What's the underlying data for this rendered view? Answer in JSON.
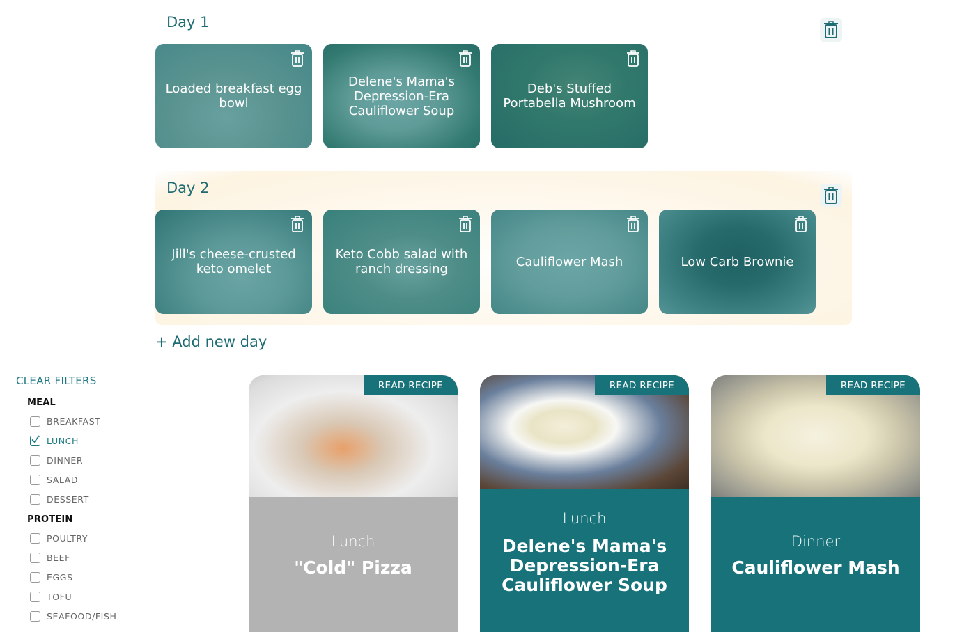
{
  "days": [
    {
      "title": "Day 1",
      "recipes": [
        {
          "name": "Loaded breakfast egg bowl"
        },
        {
          "name": "Delene's Mama's Depression-Era Cauliflower Soup"
        },
        {
          "name": "Deb's Stuffed Portabella Mushroom"
        }
      ]
    },
    {
      "title": "Day 2",
      "recipes": [
        {
          "name": "Jill's cheese-crusted keto omelet"
        },
        {
          "name": "Keto Cobb salad with ranch dressing"
        },
        {
          "name": "Cauliflower Mash"
        },
        {
          "name": "Low Carb Brownie"
        }
      ]
    }
  ],
  "add_day_label": "+ Add new day",
  "filters": {
    "clear_label": "CLEAR FILTERS",
    "groups": [
      {
        "title": "MEAL",
        "options": [
          {
            "label": "BREAKFAST",
            "checked": false
          },
          {
            "label": "LUNCH",
            "checked": true
          },
          {
            "label": "DINNER",
            "checked": false
          },
          {
            "label": "SALAD",
            "checked": false
          },
          {
            "label": "DESSERT",
            "checked": false
          }
        ]
      },
      {
        "title": "PROTEIN",
        "options": [
          {
            "label": "POULTRY",
            "checked": false
          },
          {
            "label": "BEEF",
            "checked": false
          },
          {
            "label": "EGGS",
            "checked": false
          },
          {
            "label": "TOFU",
            "checked": false
          },
          {
            "label": "SEAFOOD/FISH",
            "checked": false
          }
        ]
      }
    ]
  },
  "recipe_cards": [
    {
      "meal": "Lunch",
      "title": "\"Cold\" Pizza",
      "action": "READ RECIPE",
      "variant": "inactive"
    },
    {
      "meal": "Lunch",
      "title": "Delene's Mama's Depression-Era Cauliflower Soup",
      "action": "READ RECIPE",
      "variant": "active"
    },
    {
      "meal": "Dinner",
      "title": "Cauliflower Mash",
      "action": "READ RECIPE",
      "variant": "active"
    }
  ],
  "colors": {
    "teal": "#17727a",
    "teal_text": "#1f6b73",
    "inactive_card": "#b3b3b3",
    "card_tint": "rgba(25,120,125,0.62)"
  }
}
